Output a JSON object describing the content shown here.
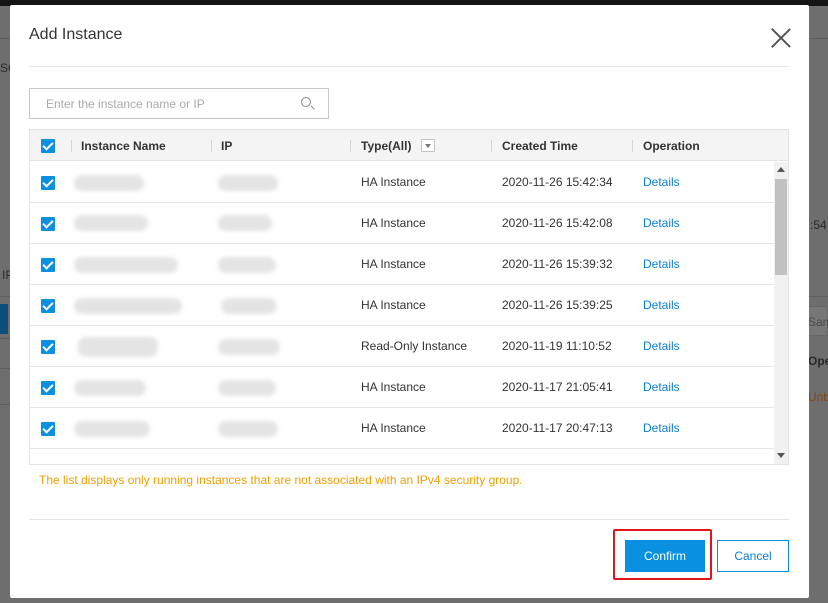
{
  "background": {
    "fragments": [
      "SG",
      "IP",
      ":54",
      "Sam",
      "Oper",
      "Unbi"
    ]
  },
  "dialog": {
    "title": "Add Instance",
    "search": {
      "placeholder": "Enter the instance name or IP",
      "value": ""
    },
    "columns": {
      "name": "Instance Name",
      "ip": "IP",
      "type": "Type(All)",
      "created": "Created Time",
      "operation": "Operation"
    },
    "rows": [
      {
        "type": "HA Instance",
        "created": "2020-11-26 15:42:34",
        "operation": "Details",
        "checked": true
      },
      {
        "type": "HA Instance",
        "created": "2020-11-26 15:42:08",
        "operation": "Details",
        "checked": true
      },
      {
        "type": "HA Instance",
        "created": "2020-11-26 15:39:32",
        "operation": "Details",
        "checked": true
      },
      {
        "type": "HA Instance",
        "created": "2020-11-26 15:39:25",
        "operation": "Details",
        "checked": true
      },
      {
        "type": "Read-Only Instance",
        "created": "2020-11-19 11:10:52",
        "operation": "Details",
        "checked": true
      },
      {
        "type": "HA Instance",
        "created": "2020-11-17 21:05:41",
        "operation": "Details",
        "checked": true
      },
      {
        "type": "HA Instance",
        "created": "2020-11-17 20:47:13",
        "operation": "Details",
        "checked": true
      }
    ],
    "note": "The list displays only running instances that are not associated with an IPv4 security group.",
    "buttons": {
      "confirm": "Confirm",
      "cancel": "Cancel"
    }
  },
  "colors": {
    "accent": "#0a90e0",
    "link": "#0a7fd9",
    "note": "#f0a000",
    "highlight": "#e0161b"
  }
}
